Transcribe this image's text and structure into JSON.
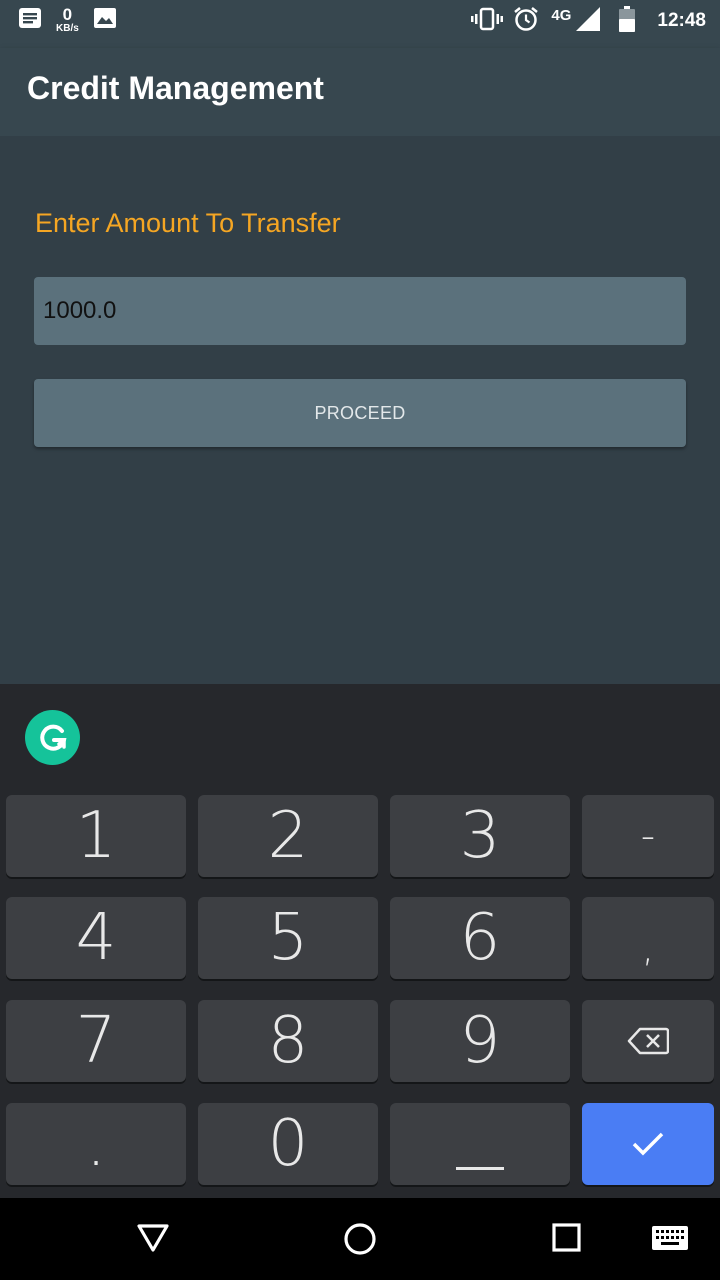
{
  "status_bar": {
    "net_speed_value": "0",
    "net_speed_unit": "KB/s",
    "network_type": "4G",
    "time": "12:48",
    "icons": [
      "notification-icon",
      "image-icon",
      "vibrate-icon",
      "alarm-icon",
      "signal-icon",
      "battery-icon"
    ]
  },
  "app_bar": {
    "title": "Credit Management"
  },
  "form": {
    "prompt": "Enter Amount To Transfer",
    "amount_value": "1000.0",
    "proceed_label": "PROCEED"
  },
  "keyboard": {
    "keys": [
      "1",
      "2",
      "3",
      "-",
      "4",
      "5",
      "6",
      ",",
      "7",
      "8",
      "9",
      "backspace",
      ".",
      "0",
      "space",
      "enter"
    ],
    "enter_color": "#4a7df4"
  },
  "colors": {
    "accent": "#f5a623",
    "app_bar": "#37474f",
    "background": "#323f47",
    "input": "#5b717c"
  }
}
